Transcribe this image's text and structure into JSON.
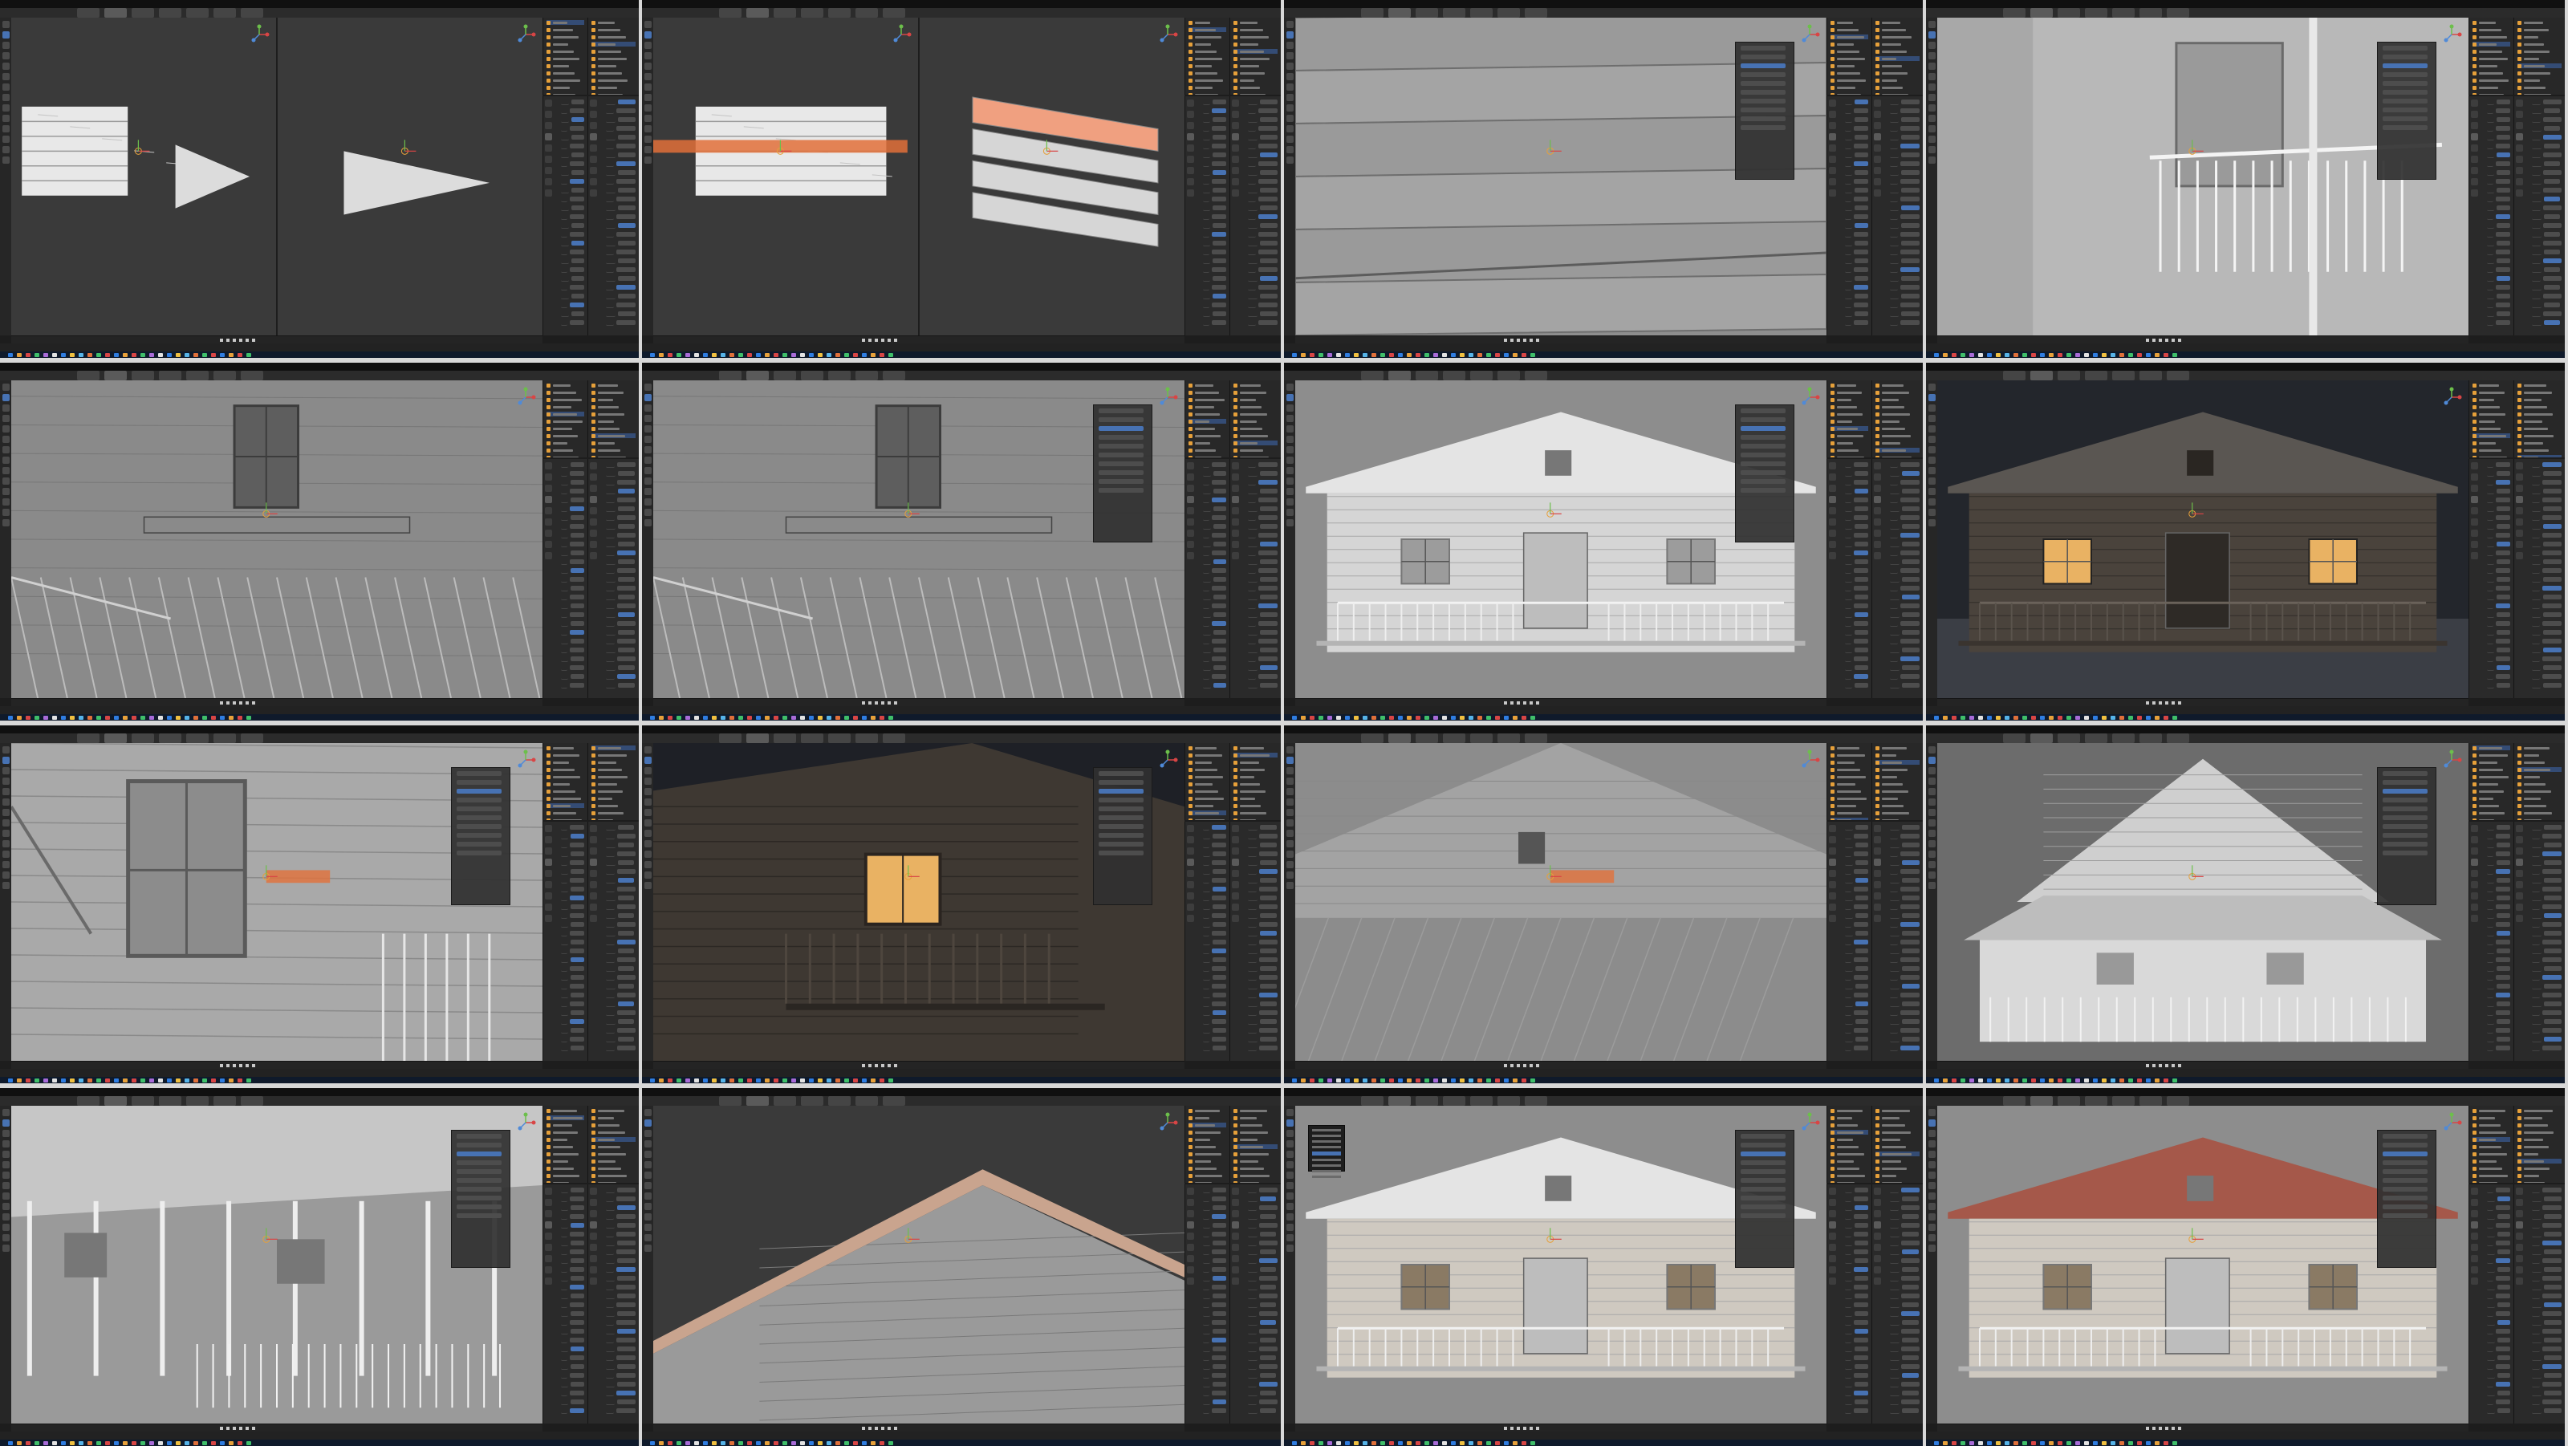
{
  "colors": {
    "ui_bg": "#1d1d1d",
    "header": "#2b2b2b",
    "viewport": "#2a2a2a",
    "selection": "#4772b3",
    "active_object": "#e6a03a",
    "highlight_edge": "#f0a080",
    "window_light": "#e9b263"
  },
  "icons": {
    "tool_icon": "tool-icon",
    "gizmo": "navigation-gizmo-icon",
    "object": "object-icon",
    "camera": "camera-icon",
    "light": "light-icon"
  },
  "tiles": [
    {
      "scene": "planks-flat",
      "viewport_split": true,
      "selected_edge": false,
      "menu_open": false
    },
    {
      "scene": "planks-selected",
      "viewport_split": true,
      "selected_edge": true,
      "menu_open": false
    },
    {
      "scene": "siding-closeup",
      "viewport_split": false,
      "selected_edge": false,
      "menu_open": false
    },
    {
      "scene": "porch-interior",
      "viewport_split": false,
      "selected_edge": false,
      "menu_open": false
    },
    {
      "scene": "gable-window",
      "viewport_split": false,
      "selected_edge": false,
      "menu_open": false
    },
    {
      "scene": "gable-window-zoom",
      "viewport_split": false,
      "selected_edge": false,
      "menu_open": false
    },
    {
      "scene": "front-porch",
      "viewport_split": false,
      "selected_edge": false,
      "menu_open": false
    },
    {
      "scene": "night-render",
      "viewport_split": false,
      "selected_edge": false,
      "menu_open": false
    },
    {
      "scene": "window-side",
      "viewport_split": false,
      "selected_edge": true,
      "menu_open": false
    },
    {
      "scene": "night-closeup",
      "viewport_split": false,
      "selected_edge": false,
      "menu_open": false
    },
    {
      "scene": "gable-plank",
      "viewport_split": false,
      "selected_edge": true,
      "menu_open": false
    },
    {
      "scene": "house-wide",
      "viewport_split": false,
      "selected_edge": false,
      "menu_open": false
    },
    {
      "scene": "porch-roof-under",
      "viewport_split": false,
      "selected_edge": false,
      "menu_open": false
    },
    {
      "scene": "roof-edge",
      "viewport_split": false,
      "selected_edge": false,
      "menu_open": false
    },
    {
      "scene": "textured-front",
      "viewport_split": false,
      "selected_edge": false,
      "menu_open": true
    },
    {
      "scene": "rusty-roof",
      "viewport_split": false,
      "selected_edge": false,
      "menu_open": false
    }
  ]
}
